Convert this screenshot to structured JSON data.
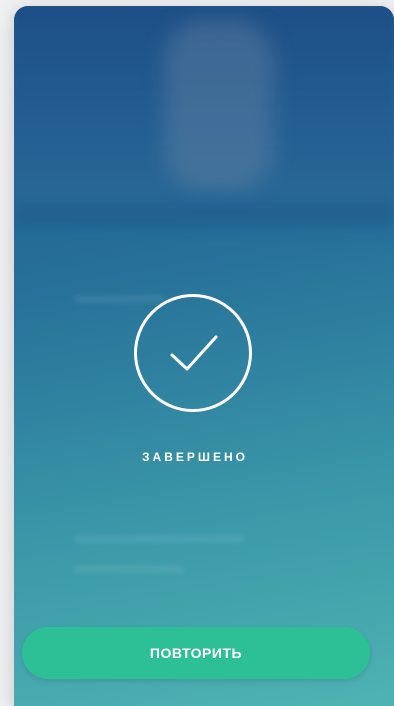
{
  "status": {
    "label": "ЗАВЕРШЕНО",
    "icon": "check-circle-icon"
  },
  "actions": {
    "retry_label": "ПОВТОРИТЬ"
  },
  "colors": {
    "button": "#2dbf95",
    "gradient_top": "#1f5a8c",
    "gradient_bottom": "#4fb3b3",
    "foreground": "#ffffff"
  }
}
